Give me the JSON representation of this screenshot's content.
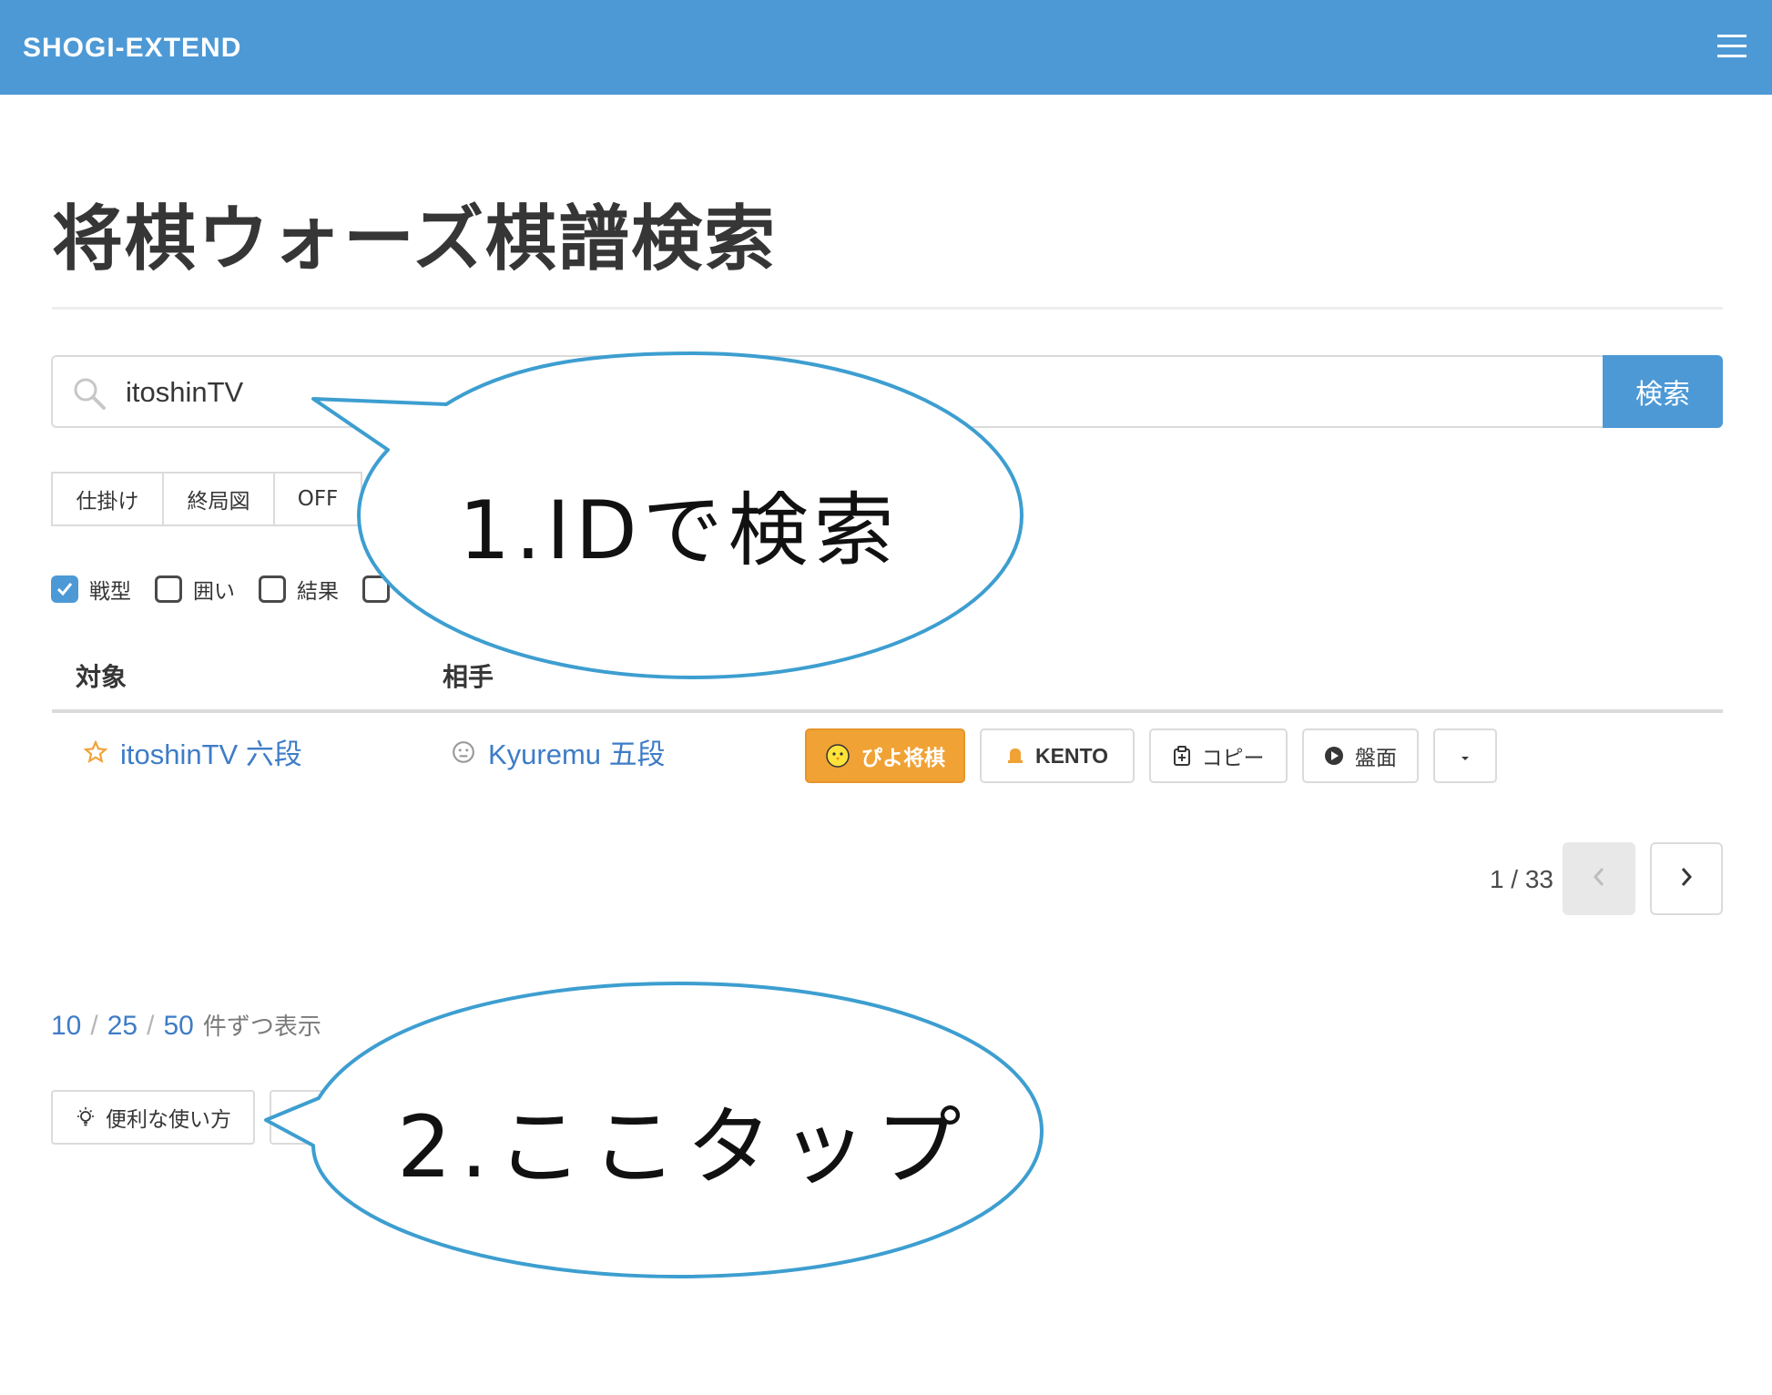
{
  "navbar": {
    "brand": "SHOGI-EXTEND",
    "menu_icon": "hamburger-icon"
  },
  "page": {
    "title": "将棋ウォーズ棋譜検索"
  },
  "search": {
    "value": "itoshinTV",
    "button_label": "検索",
    "icon": "search-icon"
  },
  "display_modes": [
    {
      "label": "仕掛け"
    },
    {
      "label": "終局図"
    },
    {
      "label": "OFF"
    }
  ],
  "columns_toggle": [
    {
      "label": "戦型",
      "checked": true
    },
    {
      "label": "囲い",
      "checked": false
    },
    {
      "label": "結果",
      "checked": false
    },
    {
      "label": "",
      "checked": false
    }
  ],
  "table": {
    "headers": {
      "target": "対象",
      "opponent": "相手"
    },
    "rows": [
      {
        "target": "itoshinTV 六段",
        "target_icon": "star-icon",
        "opponent": "Kyuremu 五段",
        "opponent_icon": "neutral-face-icon",
        "actions": {
          "piyo": "ぴよ将棋",
          "kento": "KENTO",
          "copy": "コピー",
          "board": "盤面"
        }
      }
    ]
  },
  "pagination": {
    "info": "1 / 33",
    "current": 1,
    "total": 33
  },
  "per_page": {
    "options": [
      "10",
      "25",
      "50"
    ],
    "suffix": "件ずつ表示"
  },
  "tips_button": {
    "label": "便利な使い方",
    "icon": "lightbulb-icon"
  },
  "annotations": {
    "callout_1": "1.IDで検索",
    "callout_2": "2.ここタップ"
  },
  "colors": {
    "navbar": "#4d99d6",
    "link": "#3e7cc7",
    "piyo_button": "#f0a235",
    "callout_stroke": "#3d9ed0"
  }
}
